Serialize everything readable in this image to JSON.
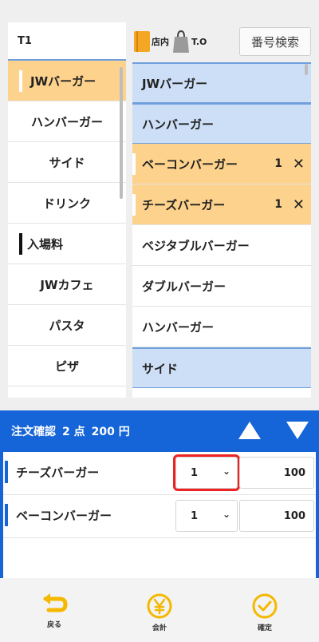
{
  "table_label": "T1",
  "header": {
    "dine_in_label": "店内",
    "takeout_label": "T.O",
    "search_button": "番号検索"
  },
  "categories": [
    "JWバーガー",
    "ハンバーガー",
    "サイド",
    "ドリンク",
    "入場料",
    "JWカフェ",
    "パスタ",
    "ピザ"
  ],
  "items": [
    {
      "label": "JWバーガー",
      "kind": "header"
    },
    {
      "label": "ハンバーガー",
      "kind": "header"
    },
    {
      "label": "ベーコンバーガー",
      "kind": "selected",
      "qty": "1",
      "remove": "✕"
    },
    {
      "label": "チーズバーガー",
      "kind": "selected",
      "qty": "1",
      "remove": "✕"
    },
    {
      "label": "ベジタブルバーガー",
      "kind": "normal"
    },
    {
      "label": "ダブルバーガー",
      "kind": "normal"
    },
    {
      "label": "ハンバーガー",
      "kind": "normal"
    },
    {
      "label": "サイド",
      "kind": "header"
    }
  ],
  "order": {
    "title": "注文確認",
    "count": "2 点",
    "total": "200 円",
    "rows": [
      {
        "name": "チーズバーガー",
        "qty": "1",
        "price": "100"
      },
      {
        "name": "ベーコンバーガー",
        "qty": "1",
        "price": "100"
      }
    ]
  },
  "nav": {
    "back": "戻る",
    "checkout": "会計",
    "confirm": "確定"
  },
  "colors": {
    "accent": "#1565d8",
    "selected": "#fdd28c",
    "category_header": "#cddff7",
    "nav_icon": "#f5b800"
  }
}
